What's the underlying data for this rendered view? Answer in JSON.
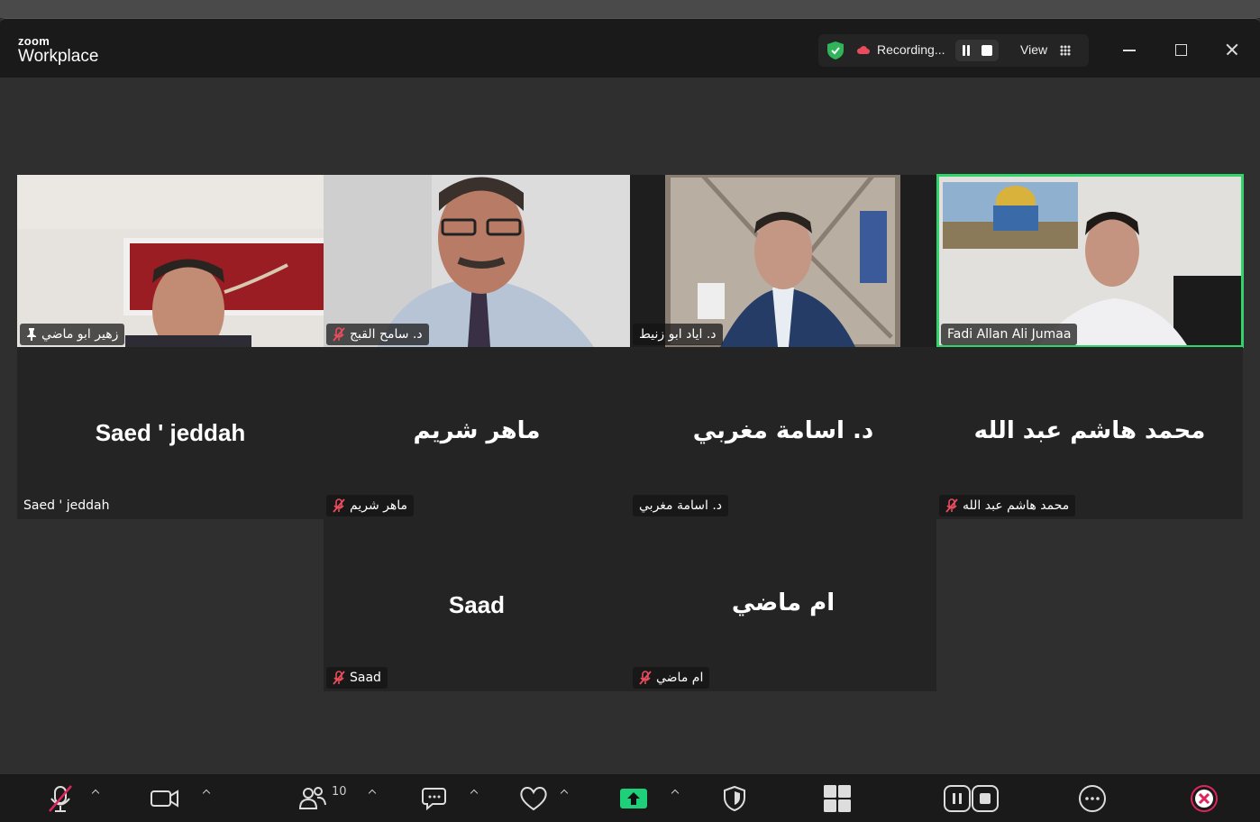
{
  "app": {
    "logo_small": "zoom",
    "logo_big": "Workplace"
  },
  "titlebar": {
    "recording_label": "Recording...",
    "view_label": "View"
  },
  "tiles": [
    {
      "tag": "زهير ابو ماضي"
    },
    {
      "tag": "د. سامح القبج"
    },
    {
      "tag": "د. اياد ابو زنيط"
    },
    {
      "tag": "Fadi Allan Ali Jumaa"
    },
    {
      "name": "Saed ' jeddah",
      "tag": "Saed ' jeddah"
    },
    {
      "name": "ماهر شريم",
      "tag": "ماهر شريم"
    },
    {
      "name": "د. اسامة مغربي",
      "tag": "د. اسامة مغربي"
    },
    {
      "name": "محمد هاشم عبد الله",
      "tag": "محمد هاشم عبد الله"
    },
    {
      "name": "Saad",
      "tag": "Saad"
    },
    {
      "name": "ام ماضي",
      "tag": "ام ماضي"
    }
  ],
  "toolbar": {
    "participants_count": "10",
    "labels": [
      "Audio",
      "Video",
      "Participants",
      "Chat",
      "React",
      "Share",
      "Host tools",
      "Breakout rooms",
      "Record",
      "More",
      "End"
    ]
  },
  "colors": {
    "active_speaker": "#2fd46a",
    "share": "#1fd07a",
    "end": "#e0245e",
    "shield": "#2fb45a"
  }
}
